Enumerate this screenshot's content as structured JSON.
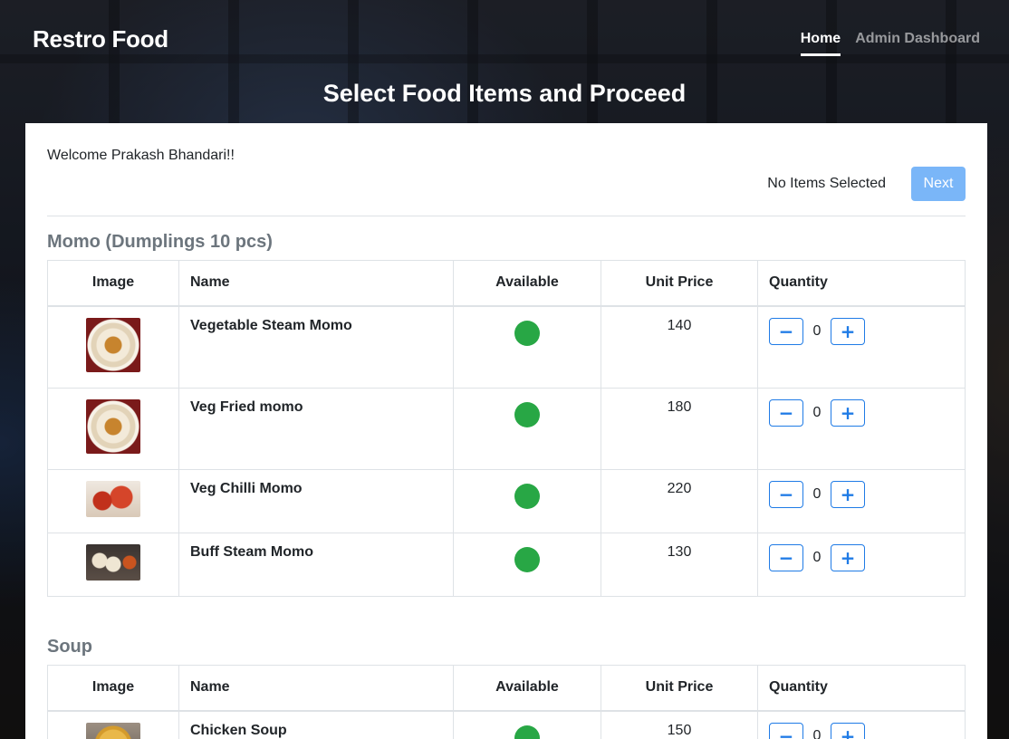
{
  "nav": {
    "brand": "Restro Food",
    "links": [
      {
        "label": "Home",
        "active": true
      },
      {
        "label": "Admin Dashboard",
        "active": false
      }
    ]
  },
  "hero_title": "Select Food Items and Proceed",
  "welcome": "Welcome Prakash Bhandari!!",
  "selection": {
    "status": "No Items Selected",
    "next_label": "Next"
  },
  "columns": {
    "image": "Image",
    "name": "Name",
    "available": "Available",
    "price": "Unit Price",
    "quantity": "Quantity"
  },
  "sections": [
    {
      "title": "Momo (Dumplings 10 pcs)",
      "items": [
        {
          "name": "Vegetable Steam Momo",
          "available": true,
          "price": "140",
          "quantity": "0",
          "icon": "steam-momo-photo"
        },
        {
          "name": "Veg Fried momo",
          "available": true,
          "price": "180",
          "quantity": "0",
          "icon": "fried-momo-photo"
        },
        {
          "name": "Veg Chilli Momo",
          "available": true,
          "price": "220",
          "quantity": "0",
          "icon": "chilli-momo-photo"
        },
        {
          "name": "Buff Steam Momo",
          "available": true,
          "price": "130",
          "quantity": "0",
          "icon": "buff-momo-photo"
        }
      ]
    },
    {
      "title": "Soup",
      "items": [
        {
          "name": "Chicken Soup",
          "available": true,
          "price": "150",
          "quantity": "0",
          "icon": "chicken-soup-photo"
        }
      ]
    }
  ],
  "icons": {
    "minus": "minus-icon",
    "plus": "plus-icon",
    "available": "available-indicator-icon"
  },
  "colors": {
    "available": "#28a745",
    "button_outline": "#1f7be6",
    "next_button": "#7ab6f8"
  }
}
